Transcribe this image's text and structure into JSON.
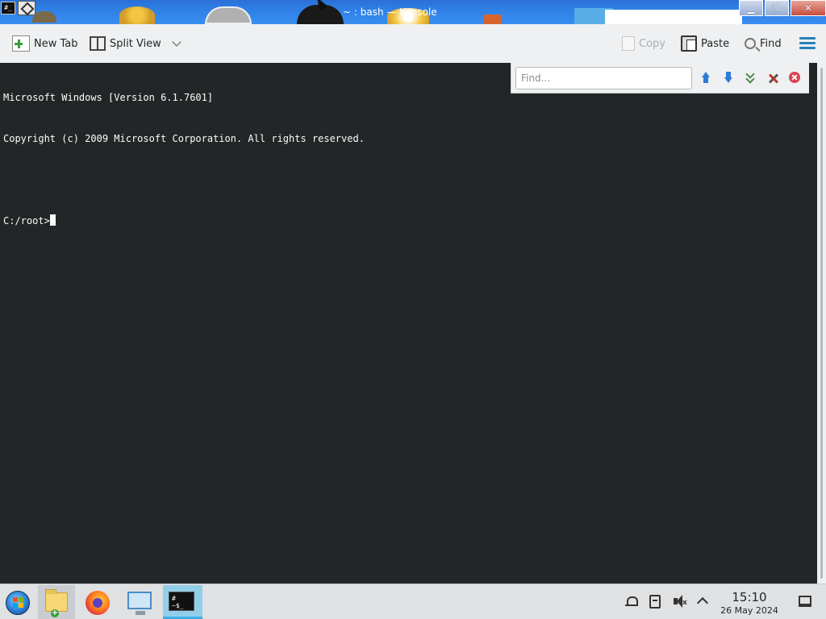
{
  "window": {
    "title": "~ : bash — Konsole",
    "app_icon_text": "#_",
    "minimize_glyph": "▁",
    "maximize_glyph": "❐",
    "close_glyph": "✕"
  },
  "toolbar": {
    "new_tab_label": "New Tab",
    "split_view_label": "Split View",
    "copy_label": "Copy",
    "paste_label": "Paste",
    "find_label": "Find"
  },
  "terminal": {
    "lines": [
      "Microsoft Windows [Version 6.1.7601]",
      "Copyright (c) 2009 Microsoft Corporation. All rights reserved.",
      ""
    ],
    "prompt": "C:/root>"
  },
  "findbar": {
    "placeholder": "Find..."
  },
  "taskbar": {
    "konsole_icon_text": "# ~$_",
    "folder_plus": "+",
    "volume_muted_glyph": "x",
    "clock_time": "15:10",
    "clock_date": "26 May 2024"
  },
  "colors": {
    "terminal_bg": "#232627",
    "terminal_fg": "#fcfcfc",
    "toolbar_bg": "#eff0f1",
    "accent": "#3daee9",
    "hamburger": "#2980b9",
    "close_red": "#da4453"
  }
}
